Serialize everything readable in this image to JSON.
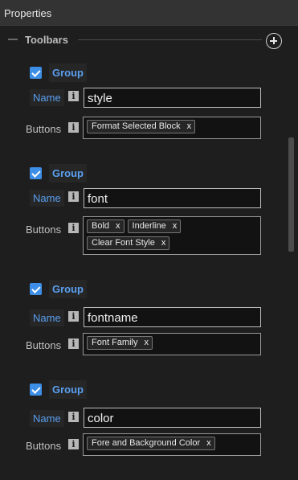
{
  "panel": {
    "title": "Properties"
  },
  "section": {
    "label": "Toolbars"
  },
  "groups": [
    {
      "checked": true,
      "label": "Group",
      "name_label": "Name",
      "name_value": "style",
      "buttons_label": "Buttons",
      "tags": [
        "Format Selected Block"
      ]
    },
    {
      "checked": true,
      "label": "Group",
      "name_label": "Name",
      "name_value": "font",
      "buttons_label": "Buttons",
      "tags": [
        "Bold",
        "Inderline",
        "Clear Font Style"
      ]
    },
    {
      "checked": true,
      "label": "Group",
      "name_label": "Name",
      "name_value": "fontname",
      "buttons_label": "Buttons",
      "tags": [
        "Font Family"
      ]
    },
    {
      "checked": true,
      "label": "Group",
      "name_label": "Name",
      "name_value": "color",
      "buttons_label": "Buttons",
      "tags": [
        "Fore and Background Color"
      ]
    }
  ],
  "icons": {
    "info": "i",
    "remove": "x",
    "add": "plus-circle-icon",
    "collapse": "minus-icon",
    "checkbox": "check-icon"
  },
  "colors": {
    "background": "#1e1e1e",
    "accent": "#3d8ee6",
    "label_blue": "#5a9ff0",
    "title_bar": "#333333"
  }
}
